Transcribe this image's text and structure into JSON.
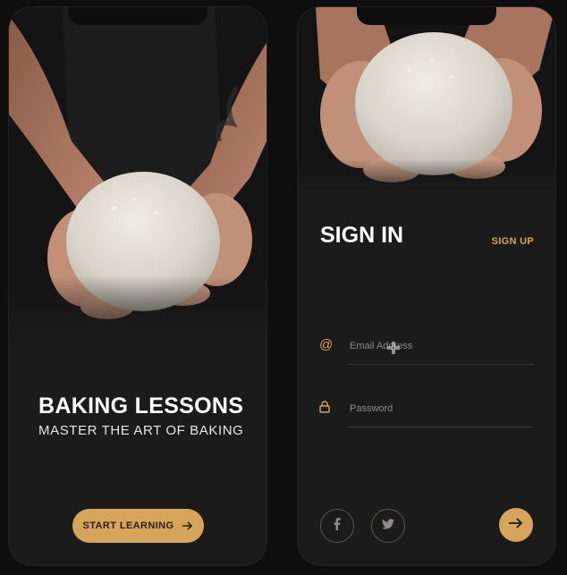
{
  "colors": {
    "accent": "#d6a55b",
    "background": "#1c1b1b",
    "text": "#ffffff"
  },
  "onboarding": {
    "title": "BAKING LESSONS",
    "subtitle": "MASTER THE ART OF BAKING",
    "cta_label": "START LEARNING",
    "cta_icon": "arrow-right-icon"
  },
  "signin": {
    "title": "SIGN IN",
    "signup_link": "SIGN UP",
    "email": {
      "icon": "at-icon",
      "placeholder": "Email Address",
      "value": ""
    },
    "password": {
      "icon": "lock-icon",
      "placeholder": "Password",
      "value": ""
    },
    "social": [
      {
        "icon": "facebook-icon"
      },
      {
        "icon": "twitter-icon"
      }
    ],
    "submit_icon": "arrow-right-icon"
  }
}
